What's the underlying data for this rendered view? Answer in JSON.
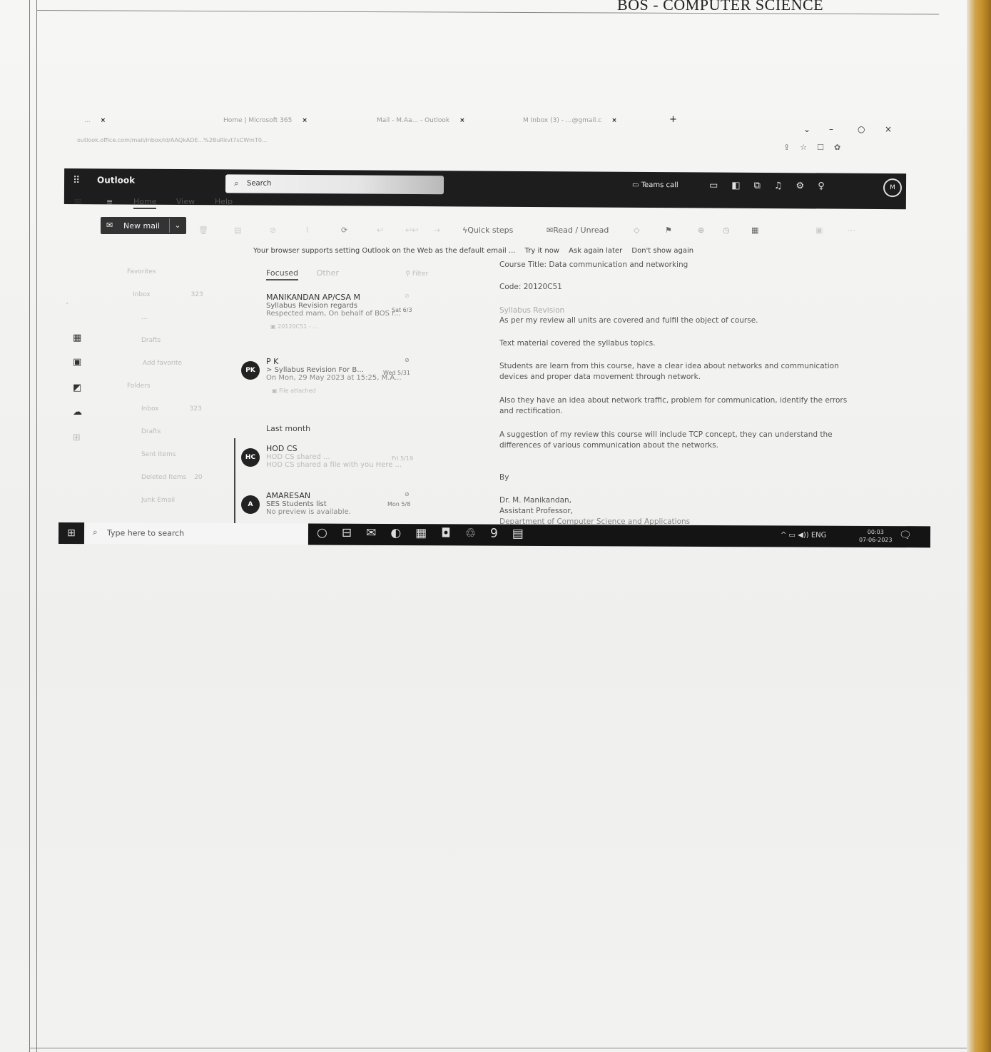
{
  "page_header": "BOS - COMPUTER SCIENCE",
  "browser": {
    "tabs": [
      {
        "label": "...",
        "close": "×"
      },
      {
        "label": "Home | Microsoft 365",
        "close": "×"
      },
      {
        "label": "Mail - M.Aa... - Outlook",
        "close": "×"
      },
      {
        "label": "M Inbox (3) - ...@gmail.c",
        "close": "×"
      }
    ],
    "new_tab": "+",
    "window_controls": [
      "⌄",
      "–",
      "○",
      "×"
    ],
    "address": "outlook.office.com/mail/inbox/id/AAQkADE...%2BuRkvt7sCWmT0...",
    "address_icons": [
      "⇪",
      "☆",
      "☐",
      "✿"
    ]
  },
  "outlook": {
    "waffle": "⠿",
    "app_name": "Outlook",
    "search_placeholder": "Search",
    "teams_call": "Teams call",
    "header_icons": [
      "▭",
      "◧",
      "⧉",
      "♫",
      "⚙",
      "♀"
    ],
    "avatar": "M",
    "ribbon_tabs": [
      "Home",
      "View",
      "Help"
    ],
    "new_mail_label": "New mail",
    "ribbon_tools": {
      "quick_steps": "Quick steps",
      "read_unread": "Read / Unread"
    },
    "banner": {
      "text": "Your browser supports setting Outlook on the Web as the default email ...",
      "try": "Try it now",
      "later": "Ask again later",
      "never": "Don't show again"
    },
    "folders": [
      "Favorites",
      "Inbox",
      "...",
      "Drafts",
      "Add favorite",
      "Folders",
      "Inbox",
      "Drafts",
      "Sent Items",
      "Deleted Items",
      "Junk Email"
    ],
    "folder_counts": {
      "inbox": "323",
      "deleted": "20"
    },
    "list_tabs": {
      "focused": "Focused",
      "other": "Other",
      "filter": "Filter"
    },
    "section_last_month": "Last month",
    "emails": [
      {
        "from": "MANIKANDAN AP/CSA M",
        "subject": "Syllabus Revision regards",
        "date": "Sat 6/3",
        "preview": "Respected mam, On behalf of BOS r...",
        "attachment": "20120C51 - ..."
      },
      {
        "initials": "PK",
        "from": "P K",
        "subject": "Syllabus Revision For B...",
        "date": "Wed 5/31",
        "preview": "On Mon, 29 May 2023 at 15:25, M.A...",
        "attachment": "File attached"
      },
      {
        "initials": "HC",
        "from": "HOD CS",
        "subject": "HOD CS shared ...",
        "date": "Fri 5/19",
        "preview": "HOD CS shared a file with you Here ..."
      },
      {
        "initials": "A",
        "from": "AMARESAN",
        "subject": "SES Students list",
        "date": "Mon 5/8",
        "preview": "No preview is available."
      }
    ],
    "reading": {
      "course_title": "Course Title: Data communication and networking",
      "code": "Code: 20120C51",
      "syllabus_label": "Syllabus Revision",
      "p1": "As per my review all units are covered and fulfil the object of course.",
      "p2": "Text material covered the syllabus topics.",
      "p3a": "Students are learn from this course, have a clear idea about networks and communication",
      "p3b": "devices and proper data movement through network.",
      "p4a": "Also they have an idea about network traffic, problem for communication, identify the errors",
      "p4b": "and rectification.",
      "p5a": "A suggestion of my review this course will include TCP concept, they can understand the",
      "p5b": "differences of various communication about the networks.",
      "by": "By",
      "sig1": "Dr. M. Manikandan,",
      "sig2": "Assistant Professor,",
      "sig3": "Department of Computer Science and Applications"
    }
  },
  "taskbar": {
    "start_icon": "⊞",
    "search_placeholder": "Type here to search",
    "apps": [
      "○",
      "⊟",
      "✉",
      "◐",
      "▦",
      "◘",
      "♲",
      "9",
      "▤"
    ],
    "tray": "^ ▭ ◀)) ENG",
    "time": "00:03",
    "date": "07-06-2023",
    "notification_icon": "🗨"
  }
}
